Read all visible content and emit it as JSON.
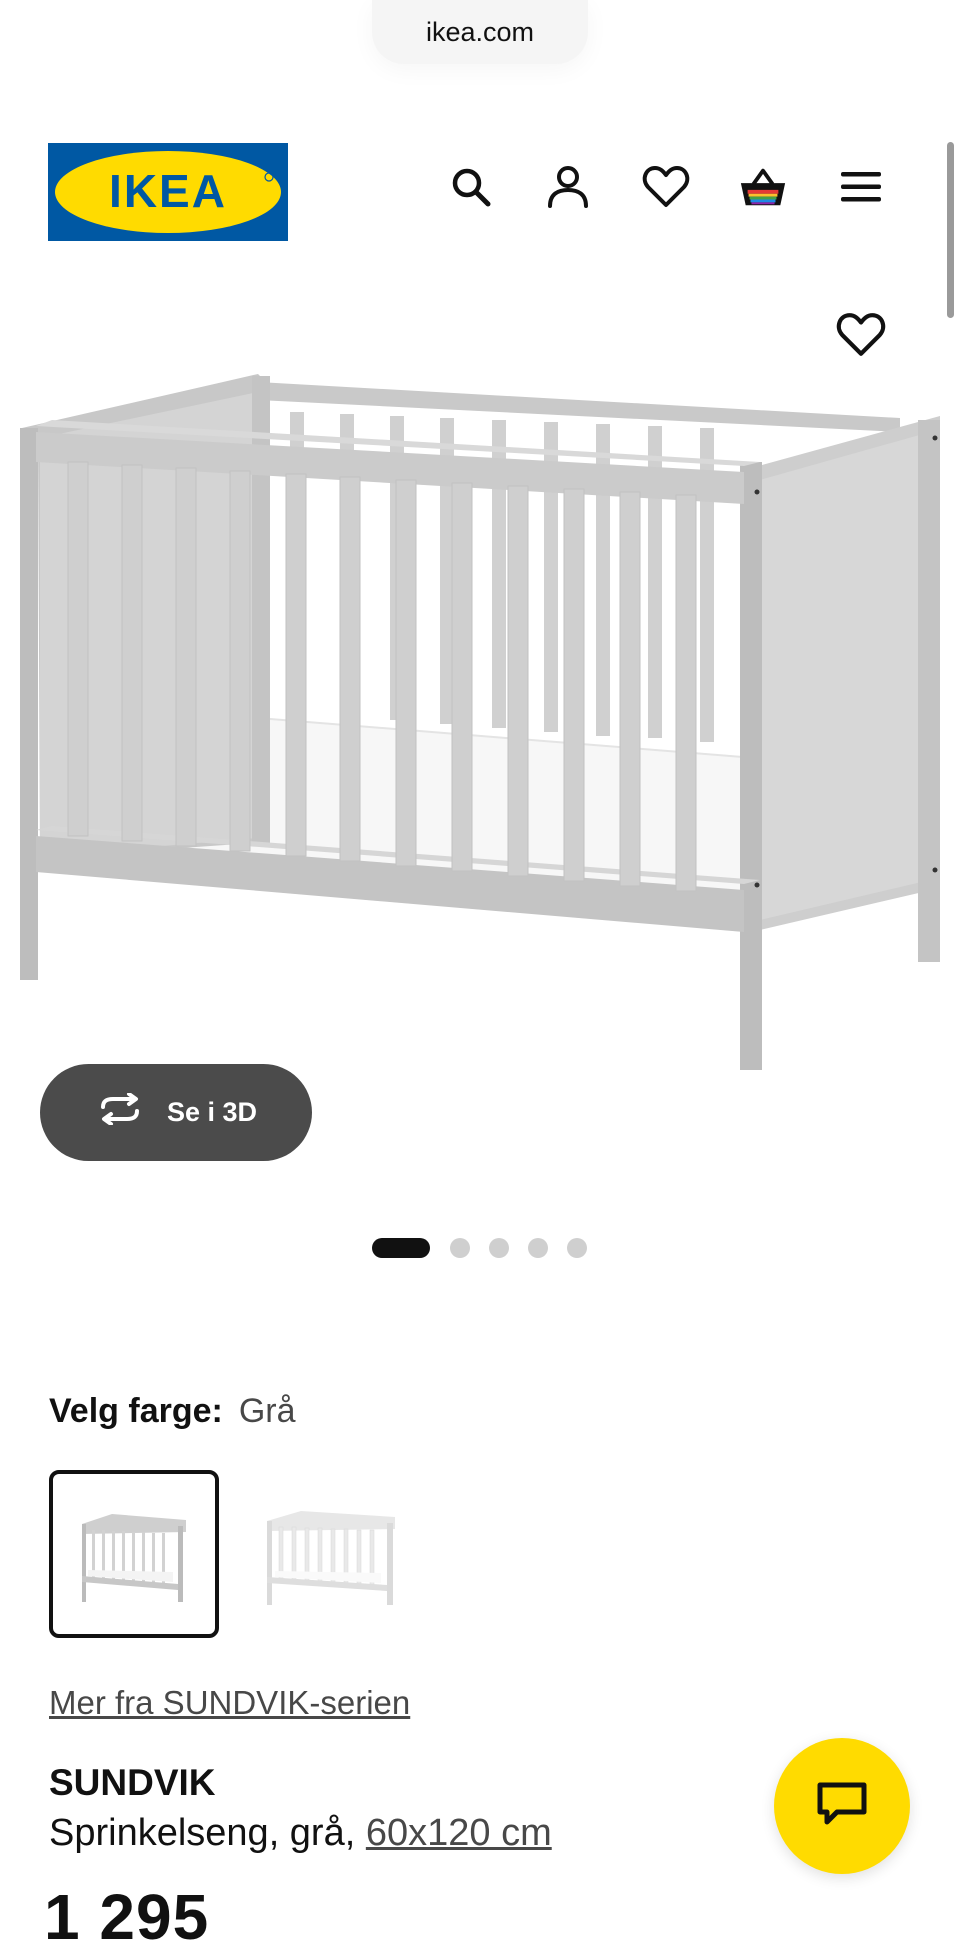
{
  "browser": {
    "url": "ikea.com"
  },
  "header": {
    "logo_text": "IKEA",
    "icons": [
      "search-icon",
      "account-icon",
      "wishlist-heart-icon",
      "shopping-basket-icon",
      "menu-hamburger-icon"
    ]
  },
  "gallery": {
    "view_3d_label": "Se i 3D",
    "image_count": 5,
    "active_index": 0
  },
  "color_picker": {
    "label": "Velg farge:",
    "selected_value": "Grå",
    "options": [
      "grå",
      "hvit"
    ]
  },
  "product": {
    "series_link": "Mer fra SUNDVIK-serien",
    "name": "SUNDVIK",
    "description_prefix": "Sprinkelseng, grå, ",
    "size_link": "60x120 cm",
    "price": "1 295"
  },
  "colors": {
    "ikea_blue": "#0058A3",
    "ikea_yellow": "#FFDB00",
    "dark_button": "#4B4B4B"
  }
}
